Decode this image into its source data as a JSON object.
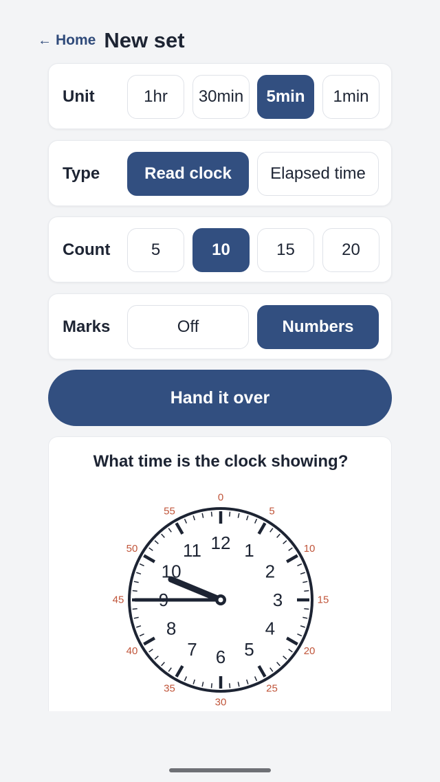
{
  "header": {
    "back_label": "Home",
    "back_icon": "arrow-left-icon",
    "title": "New set"
  },
  "settings": {
    "unit": {
      "label": "Unit",
      "options": [
        "1hr",
        "30min",
        "5min",
        "1min"
      ],
      "selected": "5min"
    },
    "type": {
      "label": "Type",
      "options": [
        "Read clock",
        "Elapsed time"
      ],
      "selected": "Read clock"
    },
    "count": {
      "label": "Count",
      "options": [
        "5",
        "10",
        "15",
        "20"
      ],
      "selected": "10"
    },
    "marks": {
      "label": "Marks",
      "options": [
        "Off",
        "Numbers"
      ],
      "selected": "Numbers"
    }
  },
  "cta_label": "Hand it over",
  "preview": {
    "question": "What time is the clock showing?",
    "clock": {
      "hour_numbers": [
        "12",
        "1",
        "2",
        "3",
        "4",
        "5",
        "6",
        "7",
        "8",
        "9",
        "10",
        "11"
      ],
      "minute_marks": [
        "0",
        "5",
        "10",
        "15",
        "20",
        "25",
        "30",
        "35",
        "40",
        "45",
        "50",
        "55"
      ],
      "time_shown": {
        "hour": 9,
        "minute": 45
      }
    }
  },
  "colors": {
    "accent": "#324f80",
    "background": "#f3f4f6",
    "text": "#1d2433",
    "minute_marks": "#c0553a"
  }
}
